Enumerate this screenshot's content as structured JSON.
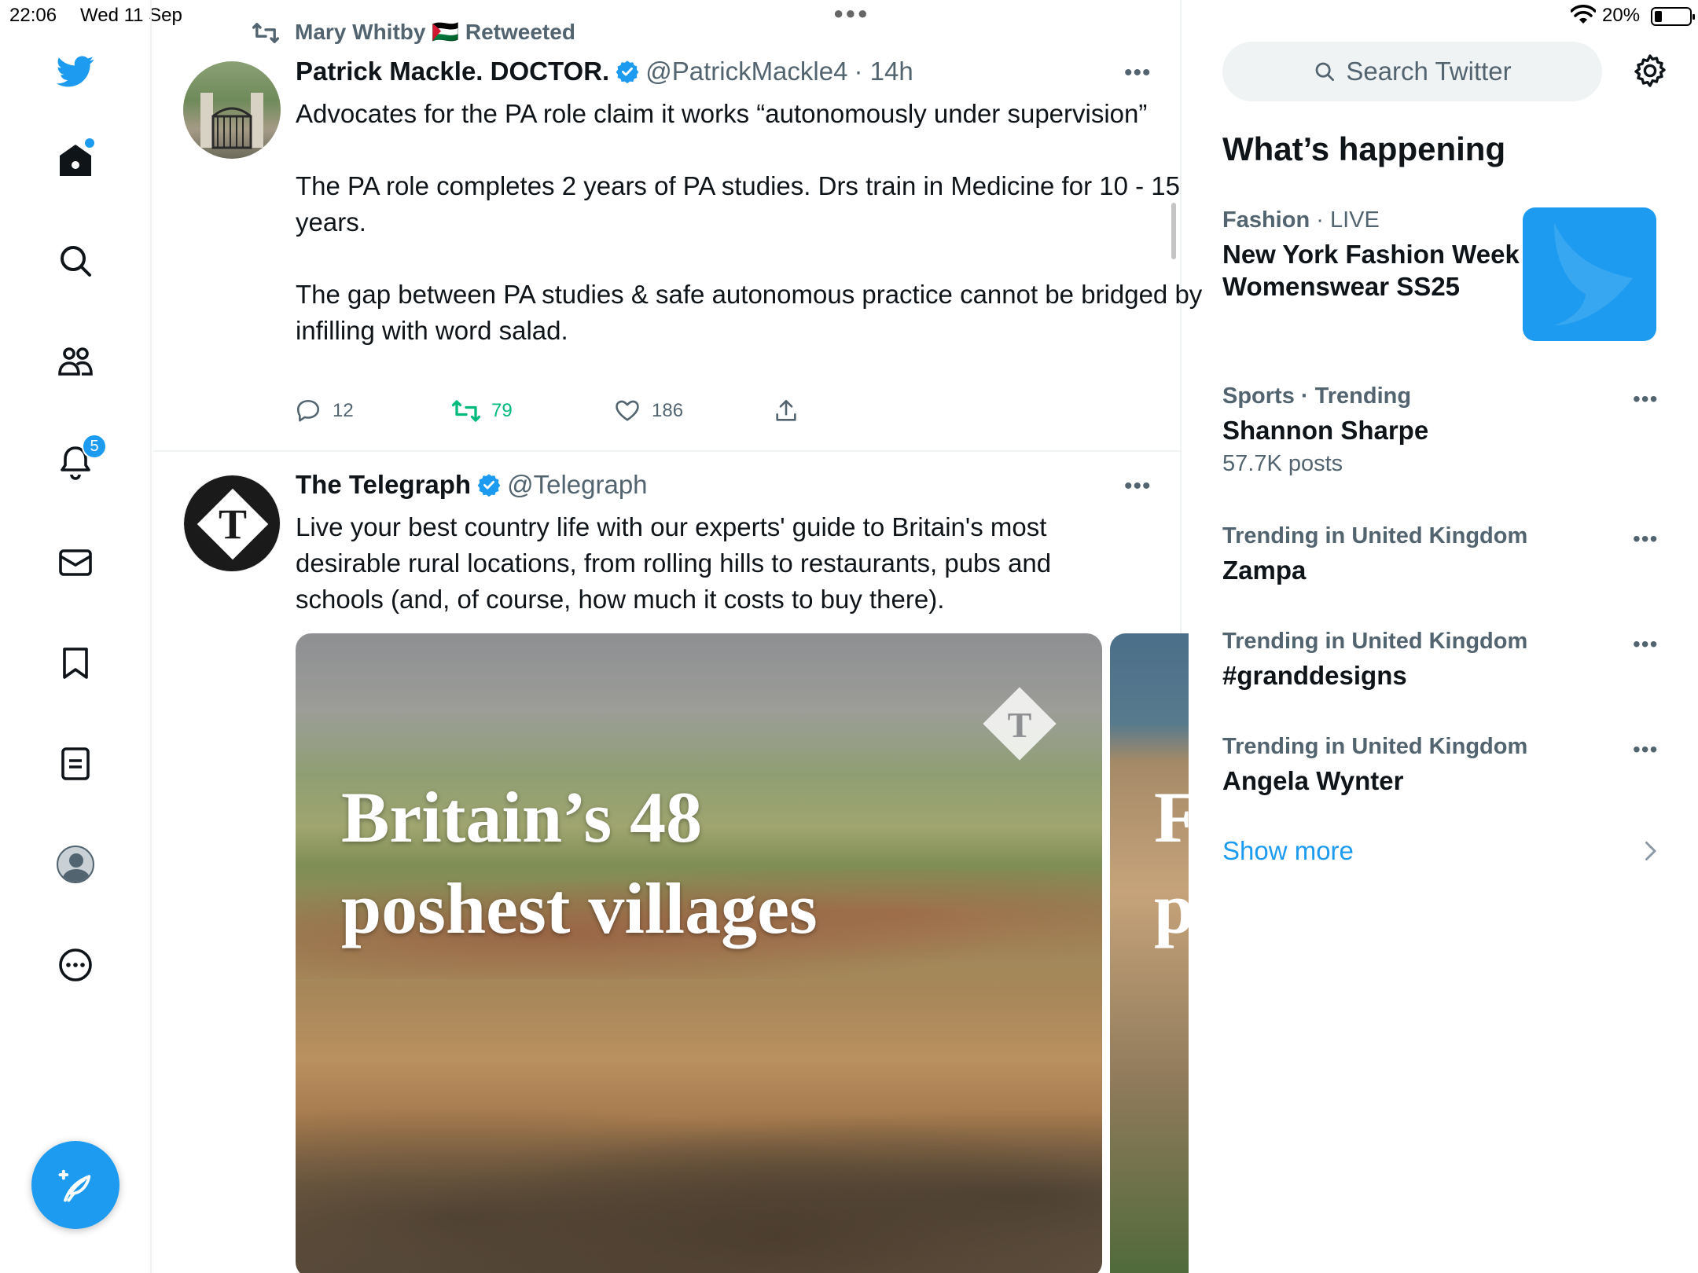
{
  "status_bar": {
    "time": "22:06",
    "date": "Wed 11 Sep",
    "battery": "20%"
  },
  "sidebar": {
    "notifications_count": "5",
    "items": [
      "twitter-logo",
      "home-icon",
      "search-icon",
      "communities-icon",
      "notifications-icon",
      "messages-icon",
      "bookmarks-icon",
      "lists-icon",
      "profile-icon",
      "more-icon"
    ]
  },
  "timeline": {
    "retweet_label": "Mary Whitby 🇵🇸 Retweeted",
    "tweets": [
      {
        "name": "Patrick Mackle. DOCTOR.",
        "handle": "@PatrickMackle4",
        "time": "· 14h",
        "text": [
          "Advocates for the PA role claim it works “autonomously under supervision”",
          "",
          "The PA role completes 2 years of PA studies.  Drs train in Medicine for 10 - 15 years.",
          "",
          "The gap between PA studies & safe autonomous practice cannot be bridged by infilling with word salad."
        ],
        "replies": "12",
        "retweets": "79",
        "likes": "186"
      },
      {
        "name": "The Telegraph",
        "handle": "@Telegraph",
        "text": "Live your best country life with our experts' guide to Britain's most desirable rural locations, from rolling hills to restaurants, pubs and schools (and, of course, how much it costs to buy there).",
        "media_headline_line1": "Britain’s 48",
        "media_headline_line2": "poshest villages",
        "media2_line1": "F",
        "media2_line2": "p"
      }
    ]
  },
  "right": {
    "search_placeholder": "Search Twitter",
    "whats_happening": "What’s happening",
    "trends": [
      {
        "category": "Fashion",
        "extra": " · LIVE",
        "topic": "New York Fashion Week Womenswear SS25"
      },
      {
        "category": "Sports · Trending",
        "topic": "Shannon Sharpe",
        "count": "57.7K posts"
      },
      {
        "category": "Trending in United Kingdom",
        "topic": "Zampa"
      },
      {
        "category": "Trending in United Kingdom",
        "topic": "#granddesigns"
      },
      {
        "category": "Trending in United Kingdom",
        "topic": "Angela Wynter"
      }
    ],
    "show_more": "Show more"
  },
  "colors": {
    "accent": "#1d9bf0",
    "retweet_green": "#00ba7c",
    "secondary_text": "#536471"
  }
}
